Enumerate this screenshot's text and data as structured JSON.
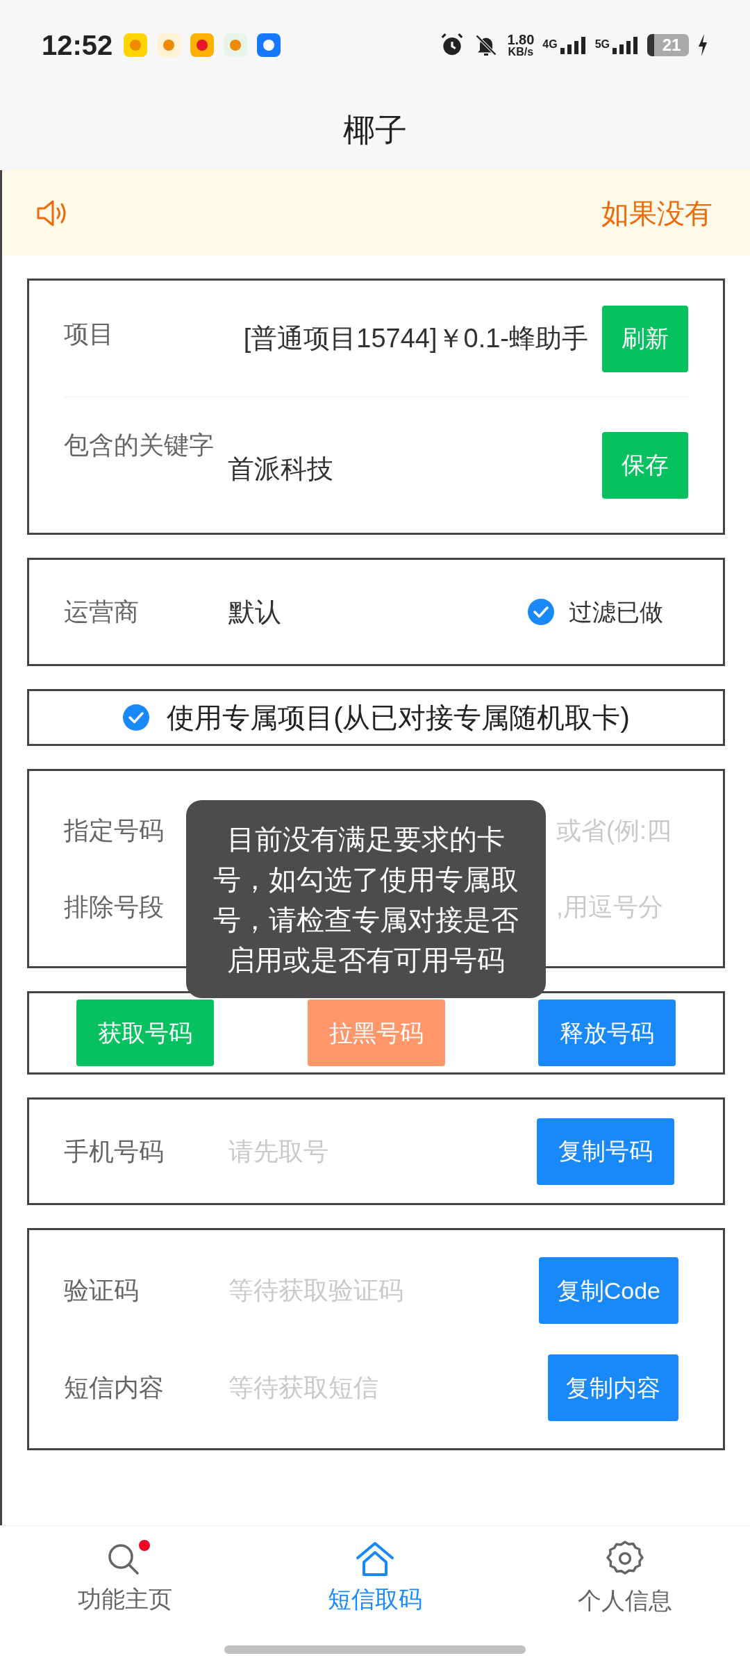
{
  "status_bar": {
    "time": "12:52",
    "speed_value": "1.80",
    "speed_unit": "KB/s",
    "network_1": "4G",
    "network_2": "5G",
    "battery": "21"
  },
  "header": {
    "title": "椰子"
  },
  "notice": {
    "text": "如果没有"
  },
  "project_card": {
    "project_label": "项目",
    "project_value": "[普通项目15744]￥0.1-蜂助手",
    "refresh_button": "刷新",
    "keyword_label": "包含的关键字",
    "keyword_value": "首派科技",
    "save_button": "保存"
  },
  "carrier_card": {
    "label": "运营商",
    "value": "默认",
    "filter": {
      "label": "过滤已做",
      "checked": true
    }
  },
  "exclusive": {
    "label": "使用专属项目(从已对接专属随机取卡)",
    "checked": true
  },
  "number_card": {
    "fields": [
      {
        "label": "指定号码",
        "placeholder": "或省(例:四"
      },
      {
        "label": "排除号段",
        "placeholder": ",用逗号分"
      }
    ]
  },
  "actions": [
    {
      "label": "获取号码",
      "color": "#07c160"
    },
    {
      "label": "拉黑号码",
      "color": "#ff976a"
    },
    {
      "label": "释放号码",
      "color": "#1989fa"
    }
  ],
  "phone_card": {
    "label": "手机号码",
    "placeholder": "请先取号",
    "button": "复制号码"
  },
  "code_card": {
    "rows": [
      {
        "label": "验证码",
        "placeholder": "等待获取验证码",
        "button": "复制Code"
      },
      {
        "label": "短信内容",
        "placeholder": "等待获取短信",
        "button": "复制内容"
      }
    ]
  },
  "toast": {
    "text": "目前没有满足要求的卡号，如勾选了使用专属取号，请检查专属对接是否启用或是否有可用号码"
  },
  "bottom_nav": [
    {
      "label": "功能主页",
      "kind": "search",
      "selected": false,
      "badge": true
    },
    {
      "label": "短信取码",
      "kind": "home",
      "selected": true,
      "badge": false
    },
    {
      "label": "个人信息",
      "kind": "settings",
      "selected": false,
      "badge": false
    }
  ]
}
